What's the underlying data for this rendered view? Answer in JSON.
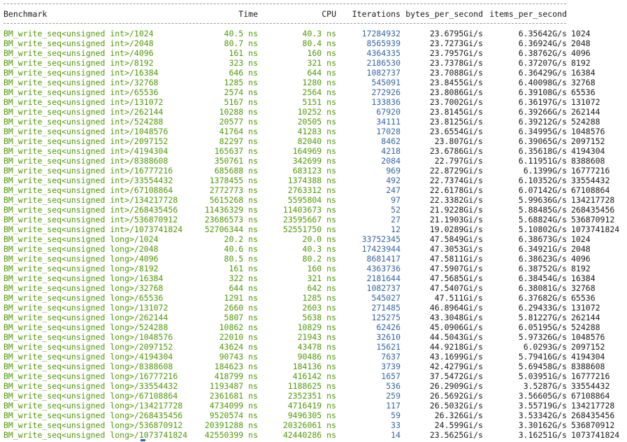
{
  "header": {
    "benchmark": "Benchmark",
    "time": "Time",
    "cpu": "CPU",
    "iterations": "Iterations",
    "bytes_per_second": "bytes_per_second",
    "items_per_second": "items_per_second"
  },
  "colors": {
    "name": "#4e9a06",
    "iterations": "#3465a4",
    "text": "#1a1a1a",
    "background": "#ffffff"
  },
  "rows": [
    [
      "BM_write_seq<unsigned int>/1024",
      "40.5 ns",
      "40.3 ns",
      "17284932",
      "23.6795Gi/s",
      "6.35642G/s",
      "1024"
    ],
    [
      "BM_write_seq<unsigned int>/2048",
      "80.7 ns",
      "80.4 ns",
      "8565939",
      "23.7273Gi/s",
      "6.36924G/s",
      "2048"
    ],
    [
      "BM_write_seq<unsigned int>/4096",
      "161 ns",
      "160 ns",
      "4364335",
      "23.7957Gi/s",
      "6.38762G/s",
      "4096"
    ],
    [
      "BM_write_seq<unsigned int>/8192",
      "323 ns",
      "321 ns",
      "2186530",
      "23.7378Gi/s",
      "6.37207G/s",
      "8192"
    ],
    [
      "BM_write_seq<unsigned int>/16384",
      "646 ns",
      "644 ns",
      "1082737",
      "23.7088Gi/s",
      "6.36429G/s",
      "16384"
    ],
    [
      "BM_write_seq<unsigned int>/32768",
      "1285 ns",
      "1280 ns",
      "545091",
      "23.8455Gi/s",
      "6.40098G/s",
      "32768"
    ],
    [
      "BM_write_seq<unsigned int>/65536",
      "2574 ns",
      "2564 ns",
      "272926",
      "23.8086Gi/s",
      "6.39108G/s",
      "65536"
    ],
    [
      "BM_write_seq<unsigned int>/131072",
      "5167 ns",
      "5151 ns",
      "133836",
      "23.7002Gi/s",
      "6.36197G/s",
      "131072"
    ],
    [
      "BM_write_seq<unsigned int>/262144",
      "10288 ns",
      "10252 ns",
      "67920",
      "23.8145Gi/s",
      "6.39266G/s",
      "262144"
    ],
    [
      "BM_write_seq<unsigned int>/524288",
      "20577 ns",
      "20505 ns",
      "34111",
      "23.8125Gi/s",
      "6.39212G/s",
      "524288"
    ],
    [
      "BM_write_seq<unsigned int>/1048576",
      "41764 ns",
      "41283 ns",
      "17028",
      "23.6554Gi/s",
      "6.34995G/s",
      "1048576"
    ],
    [
      "BM_write_seq<unsigned int>/2097152",
      "82297 ns",
      "82040 ns",
      "8462",
      "23.807Gi/s",
      "6.39065G/s",
      "2097152"
    ],
    [
      "BM_write_seq<unsigned int>/4194304",
      "165637 ns",
      "164969 ns",
      "4218",
      "23.6786Gi/s",
      "6.35618G/s",
      "4194304"
    ],
    [
      "BM_write_seq<unsigned int>/8388608",
      "350761 ns",
      "342699 ns",
      "2084",
      "22.797Gi/s",
      "6.11951G/s",
      "8388608"
    ],
    [
      "BM_write_seq<unsigned int>/16777216",
      "685688 ns",
      "683123 ns",
      "969",
      "22.8729Gi/s",
      "6.1399G/s",
      "16777216"
    ],
    [
      "BM_write_seq<unsigned int>/33554432",
      "1378455 ns",
      "1374388 ns",
      "492",
      "22.7374Gi/s",
      "6.10352G/s",
      "33554432"
    ],
    [
      "BM_write_seq<unsigned int>/67108864",
      "2772773 ns",
      "2763312 ns",
      "247",
      "22.6178Gi/s",
      "6.07142G/s",
      "67108864"
    ],
    [
      "BM_write_seq<unsigned int>/134217728",
      "5615268 ns",
      "5595804 ns",
      "97",
      "22.3382Gi/s",
      "5.99636G/s",
      "134217728"
    ],
    [
      "BM_write_seq<unsigned int>/268435456",
      "11436329 ns",
      "11403673 ns",
      "52",
      "21.9228Gi/s",
      "5.88485G/s",
      "268435456"
    ],
    [
      "BM_write_seq<unsigned int>/536870912",
      "23686573 ns",
      "23595667 ns",
      "27",
      "21.1903Gi/s",
      "5.68824G/s",
      "536870912"
    ],
    [
      "BM_write_seq<unsigned int>/1073741824",
      "52706344 ns",
      "52551750 ns",
      "12",
      "19.0289Gi/s",
      "5.10802G/s",
      "1073741824"
    ],
    [
      "BM_write_seq<unsigned long>/1024",
      "20.2 ns",
      "20.0 ns",
      "33752345",
      "47.5849Gi/s",
      "6.38673G/s",
      "1024"
    ],
    [
      "BM_write_seq<unsigned long>/2048",
      "40.6 ns",
      "40.3 ns",
      "17423944",
      "47.3053Gi/s",
      "6.34921G/s",
      "2048"
    ],
    [
      "BM_write_seq<unsigned long>/4096",
      "80.5 ns",
      "80.2 ns",
      "8681417",
      "47.5811Gi/s",
      "6.38623G/s",
      "4096"
    ],
    [
      "BM_write_seq<unsigned long>/8192",
      "161 ns",
      "160 ns",
      "4363736",
      "47.5907Gi/s",
      "6.38752G/s",
      "8192"
    ],
    [
      "BM_write_seq<unsigned long>/16384",
      "322 ns",
      "321 ns",
      "2181644",
      "47.5685Gi/s",
      "6.38454G/s",
      "16384"
    ],
    [
      "BM_write_seq<unsigned long>/32768",
      "644 ns",
      "642 ns",
      "1082737",
      "47.5407Gi/s",
      "6.38081G/s",
      "32768"
    ],
    [
      "BM_write_seq<unsigned long>/65536",
      "1291 ns",
      "1285 ns",
      "545027",
      "47.511Gi/s",
      "6.37682G/s",
      "65536"
    ],
    [
      "BM_write_seq<unsigned long>/131072",
      "2660 ns",
      "2603 ns",
      "271485",
      "46.8964Gi/s",
      "6.29433G/s",
      "131072"
    ],
    [
      "BM_write_seq<unsigned long>/262144",
      "5807 ns",
      "5638 ns",
      "125275",
      "43.3048Gi/s",
      "5.81227G/s",
      "262144"
    ],
    [
      "BM_write_seq<unsigned long>/524288",
      "10862 ns",
      "10829 ns",
      "62426",
      "45.0906Gi/s",
      "6.05195G/s",
      "524288"
    ],
    [
      "BM_write_seq<unsigned long>/1048576",
      "22010 ns",
      "21943 ns",
      "32610",
      "44.5043Gi/s",
      "5.97326G/s",
      "1048576"
    ],
    [
      "BM_write_seq<unsigned long>/2097152",
      "43624 ns",
      "43478 ns",
      "15621",
      "44.9218Gi/s",
      "6.0293G/s",
      "2097152"
    ],
    [
      "BM_write_seq<unsigned long>/4194304",
      "90743 ns",
      "90486 ns",
      "7637",
      "43.1699Gi/s",
      "5.79416G/s",
      "4194304"
    ],
    [
      "BM_write_seq<unsigned long>/8388608",
      "184623 ns",
      "184136 ns",
      "3739",
      "42.4279Gi/s",
      "5.69458G/s",
      "8388608"
    ],
    [
      "BM_write_seq<unsigned long>/16777216",
      "418799 ns",
      "416142 ns",
      "1657",
      "37.5472Gi/s",
      "5.03951G/s",
      "16777216"
    ],
    [
      "BM_write_seq<unsigned long>/33554432",
      "1193487 ns",
      "1188625 ns",
      "536",
      "26.2909Gi/s",
      "3.5287G/s",
      "33554432"
    ],
    [
      "BM_write_seq<unsigned long>/67108864",
      "2361681 ns",
      "2352351 ns",
      "259",
      "26.5692Gi/s",
      "3.56605G/s",
      "67108864"
    ],
    [
      "BM_write_seq<unsigned long>/134217728",
      "4734099 ns",
      "4716419 ns",
      "117",
      "26.5032Gi/s",
      "3.55719G/s",
      "134217728"
    ],
    [
      "BM_write_seq<unsigned long>/268435456",
      "9520574 ns",
      "9496305 ns",
      "59",
      "26.326Gi/s",
      "3.53342G/s",
      "268435456"
    ],
    [
      "BM_write_seq<unsigned long>/536870912",
      "20391288 ns",
      "20326061 ns",
      "33",
      "24.599Gi/s",
      "3.30162G/s",
      "536870912"
    ],
    [
      "BM_write_seq<unsigned long>/1073741824",
      "42550399 ns",
      "42440286 ns",
      "14",
      "23.5625Gi/s",
      "3.16251G/s",
      "1073741824"
    ]
  ]
}
